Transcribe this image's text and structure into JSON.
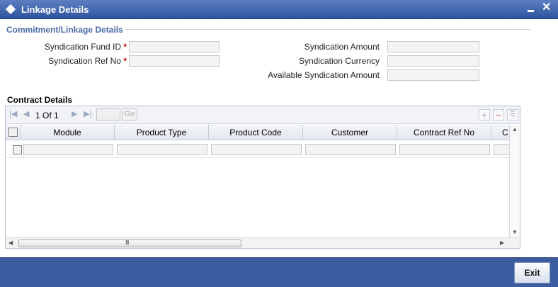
{
  "window": {
    "title": "Linkage Details"
  },
  "section": {
    "title": "Commitment/Linkage Details"
  },
  "fields": {
    "fund_id": {
      "label": "Syndication Fund ID",
      "required_mark": "*",
      "value": ""
    },
    "ref_no": {
      "label": "Syndication Ref No",
      "required_mark": "*",
      "value": ""
    },
    "amount": {
      "label": "Syndication Amount",
      "value": ""
    },
    "currency": {
      "label": "Syndication Currency",
      "value": ""
    },
    "available_amount": {
      "label": "Available Syndication Amount",
      "value": ""
    }
  },
  "contract": {
    "title": "Contract Details",
    "pager": {
      "current": "1",
      "of_label": "Of",
      "total": "1",
      "go_label": "Go"
    },
    "columns": [
      "Module",
      "Product Type",
      "Product Code",
      "Customer",
      "Contract Ref No",
      "C"
    ],
    "rows": [
      {
        "module": "",
        "product_type": "",
        "product_code": "",
        "customer": "",
        "contract_ref_no": ""
      }
    ]
  },
  "icons": {
    "first": "first-page-icon",
    "prev": "previous-page-icon",
    "next": "next-page-icon",
    "last": "last-page-icon",
    "add": "add-row-icon",
    "delete": "delete-row-icon",
    "view": "single-view-icon",
    "grip": "III"
  },
  "footer": {
    "exit_label": "Exit"
  },
  "colors": {
    "titlebar": "#2f55a0",
    "footer": "#3b5c9e",
    "section_title": "#4a6aa6",
    "required": "#cc0000"
  }
}
